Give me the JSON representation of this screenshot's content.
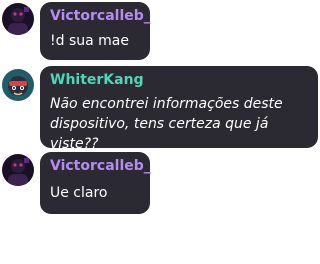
{
  "messages": [
    {
      "author": "Victorcalleb_",
      "author_color": "#b78cf2",
      "text": "!d sua mae",
      "avatar_icon": "dark-purple-avatar-icon"
    },
    {
      "author": "WhiterKang",
      "author_color": "#4fd6b6",
      "text": "Não encontrei informações deste dispositivo, tens certeza que já viste??",
      "avatar_icon": "cartoon-character-avatar-icon"
    },
    {
      "author": "Victorcalleb_",
      "author_color": "#b78cf2",
      "text": "Ue claro",
      "avatar_icon": "dark-purple-avatar-icon"
    }
  ]
}
